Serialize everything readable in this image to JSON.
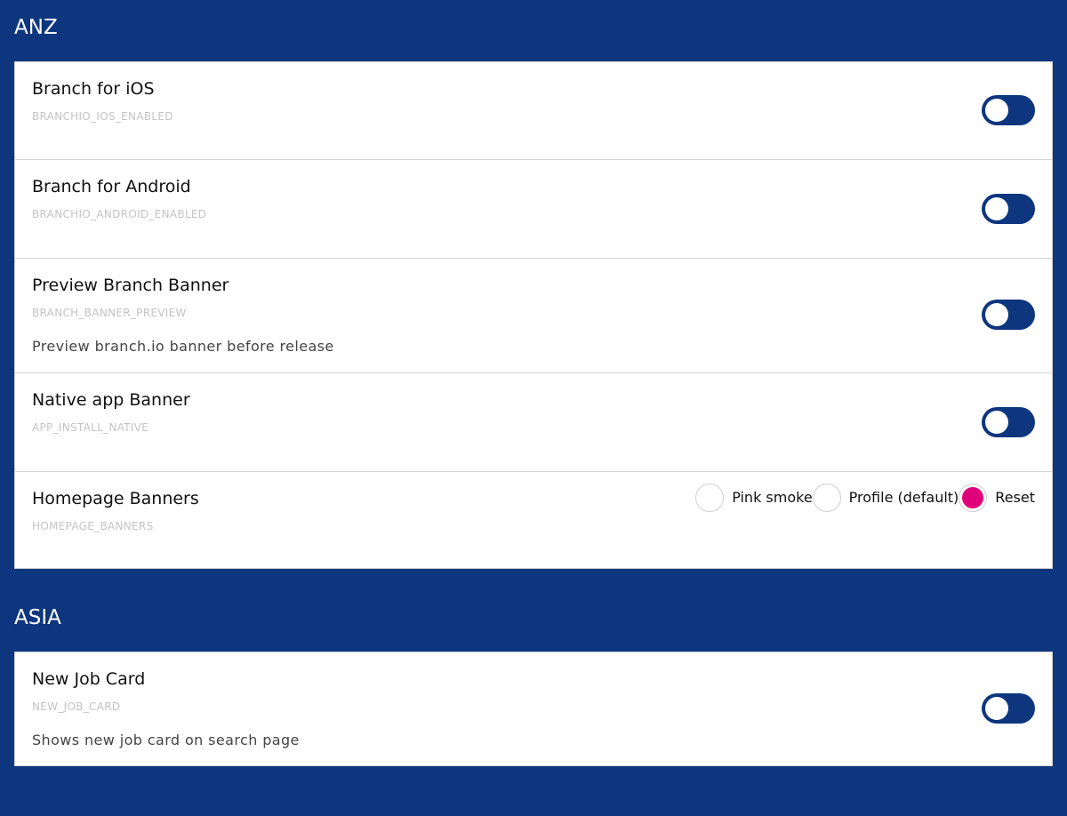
{
  "sections": [
    {
      "title": "ANZ",
      "rows": [
        {
          "title": "Branch for iOS",
          "key": "BRANCHIO_IOS_ENABLED",
          "description": ""
        },
        {
          "title": "Branch for Android",
          "key": "BRANCHIO_ANDROID_ENABLED",
          "description": ""
        },
        {
          "title": "Preview Branch Banner",
          "key": "BRANCH_BANNER_PREVIEW",
          "description": "Preview branch.io banner before release"
        },
        {
          "title": "Native app Banner",
          "key": "APP_INSTALL_NATIVE",
          "description": ""
        },
        {
          "title": "Homepage Banners",
          "key": "HOMEPAGE_BANNERS",
          "options": [
            {
              "label": "Pink smoke",
              "checked": false
            },
            {
              "label": "Profile (default)",
              "checked": false
            },
            {
              "label": "Reset",
              "checked": true
            }
          ]
        }
      ]
    },
    {
      "title": "ASIA",
      "rows": [
        {
          "title": "New Job Card",
          "key": "NEW_JOB_CARD",
          "description": "Shows new job card on search page"
        }
      ]
    }
  ],
  "colors": {
    "background": "#0e367e",
    "toggle": "#0e367e",
    "radio_selected": "#e0007a"
  },
  "icons": {
    "toggle": "toggle-switch",
    "radio": "radio-button"
  }
}
